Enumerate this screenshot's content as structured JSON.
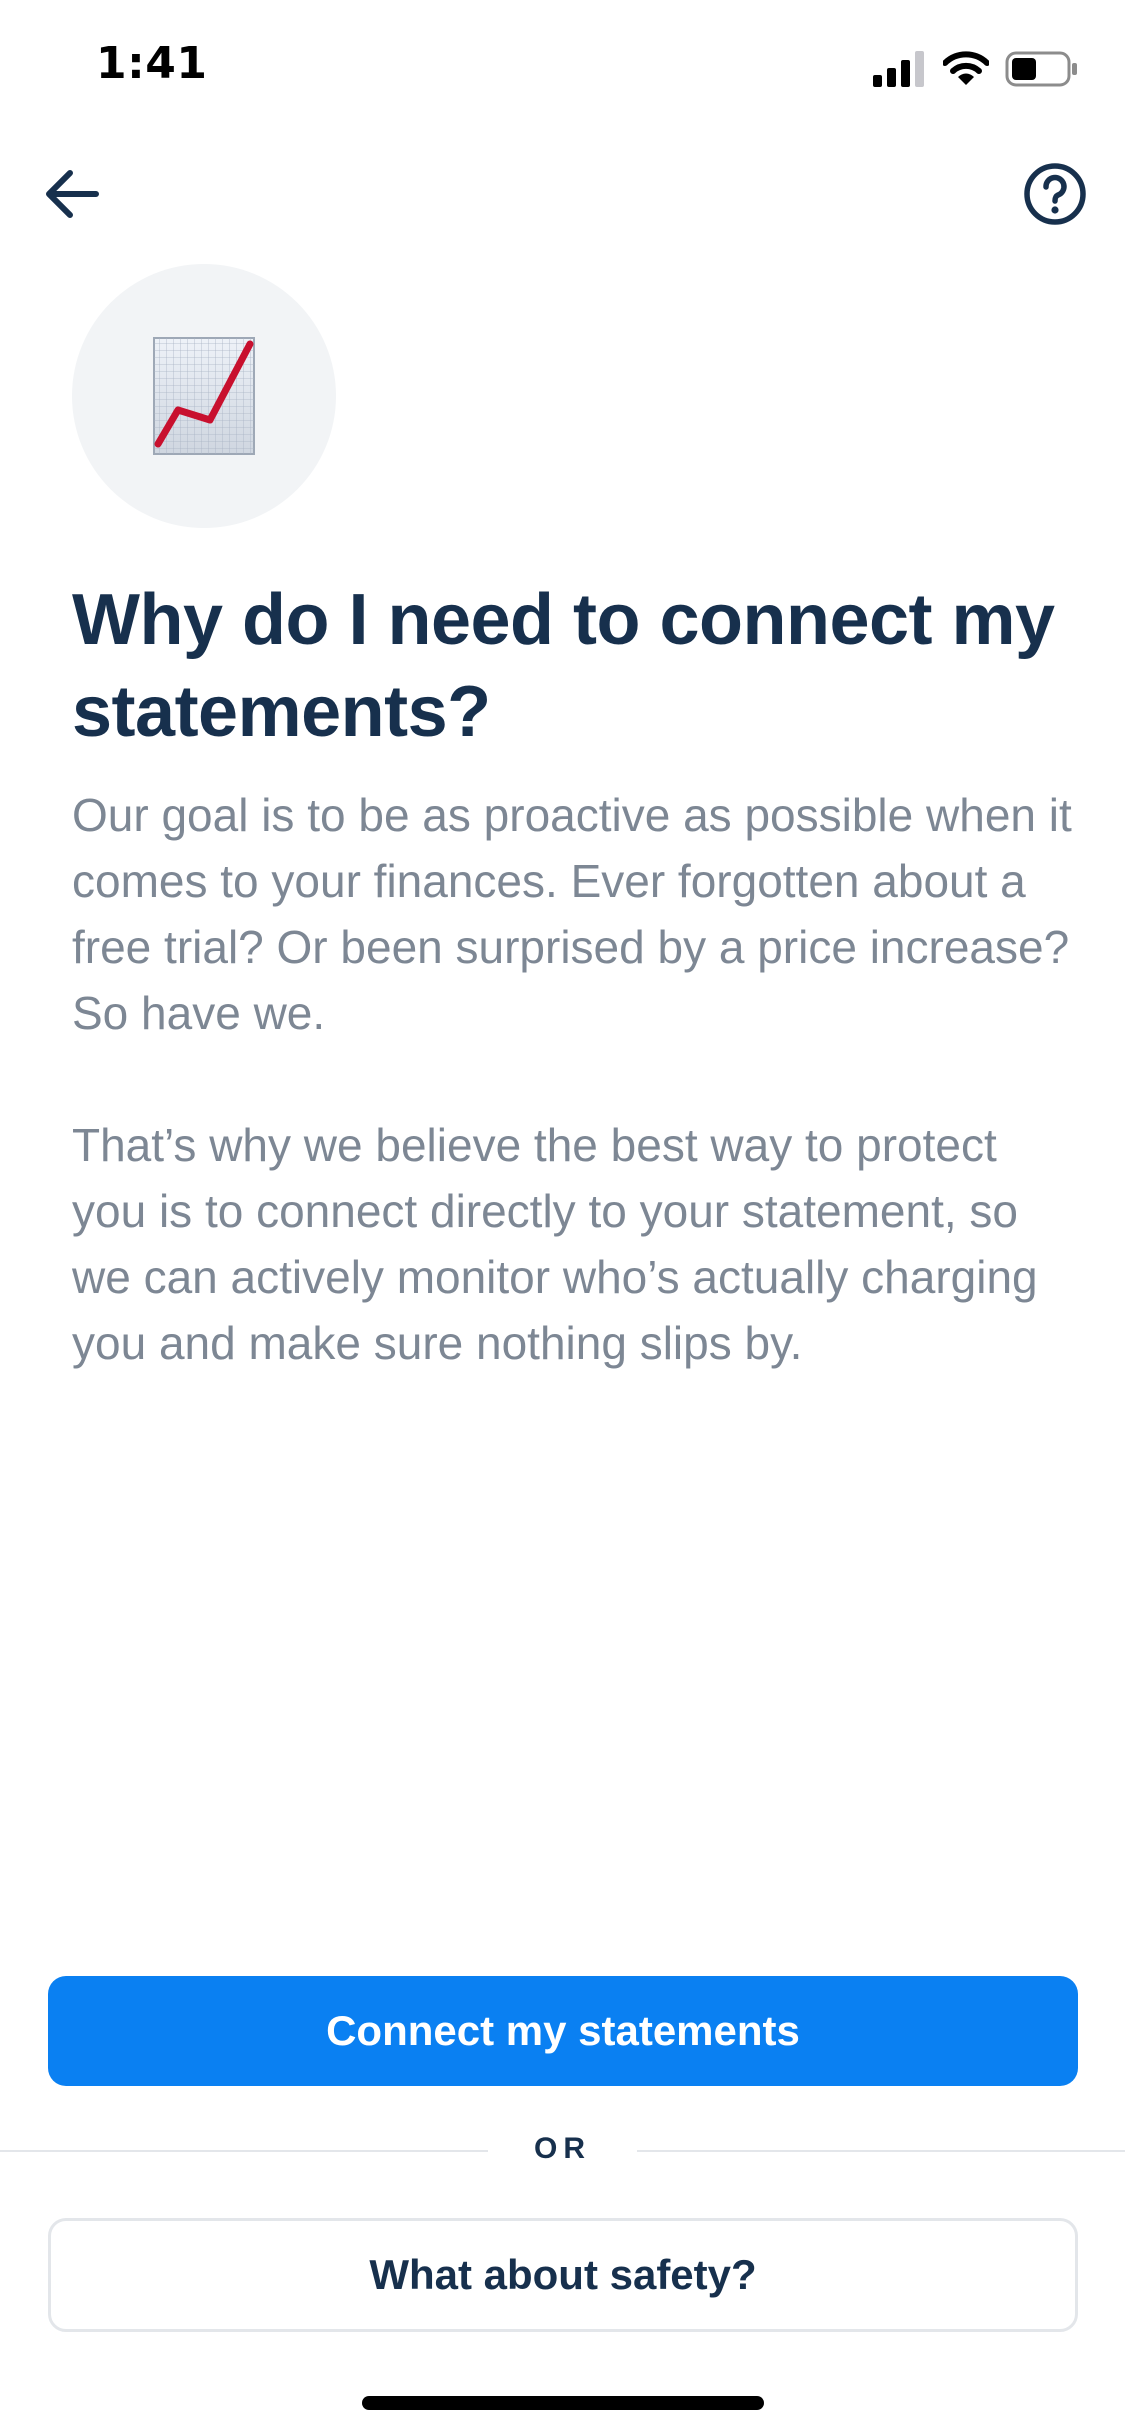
{
  "status_bar": {
    "time": "1:41",
    "icons": [
      "cellular-signal-icon",
      "wifi-icon",
      "battery-icon"
    ]
  },
  "nav": {
    "back_icon": "arrow-left-icon",
    "help_icon": "question-circle-icon"
  },
  "hero": {
    "icon": "chart-increasing-icon"
  },
  "content": {
    "title": "Why do I need to connect my statements?",
    "paragraph_1": "Our goal is to be as proactive as possible when it comes to your finances. Ever forgotten about a free trial? Or been surprised by a price increase? So have we.",
    "paragraph_2": "That’s why we believe the best way to protect you is to connect directly to your statement, so we can actively monitor who’s actually charging you and make sure nothing slips by."
  },
  "actions": {
    "primary_label": "Connect my statements",
    "divider_label": "OR",
    "secondary_label": "What about safety?"
  },
  "colors": {
    "primary": "#0a80f2",
    "title": "#17304d",
    "body": "#7d8794",
    "hero_background": "#f2f4f6",
    "chart_line": "#c8102e"
  }
}
